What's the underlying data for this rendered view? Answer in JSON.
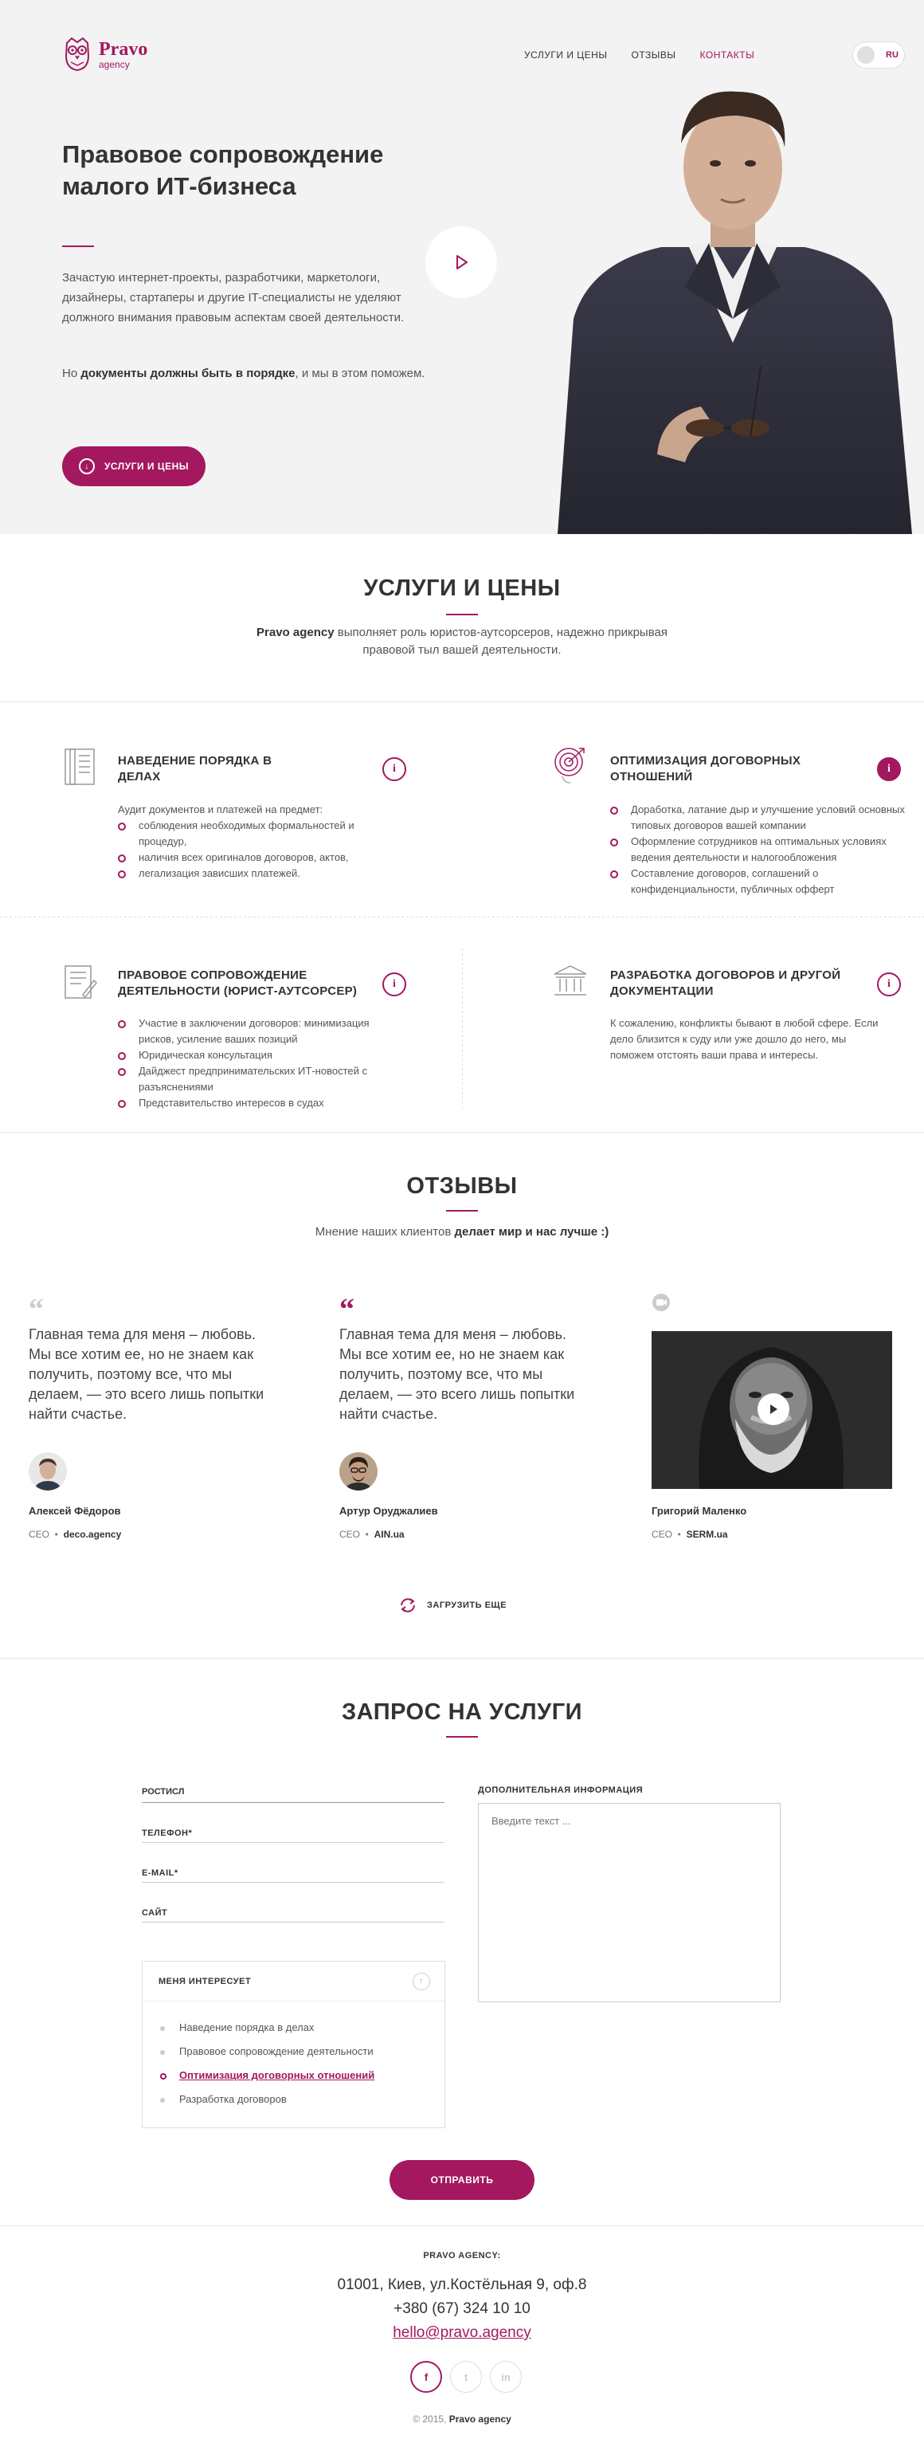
{
  "header": {
    "logo_title": "Pravo",
    "logo_sub": "agency",
    "nav": [
      {
        "label": "УСЛУГИ И ЦЕНЫ"
      },
      {
        "label": "ОТЗЫВЫ"
      },
      {
        "label": "КОНТАКТЫ"
      }
    ],
    "lang": "RU"
  },
  "hero": {
    "title": "Правовое сопровождение малого ИТ-бизнеса",
    "text": "Зачастую интернет-проекты, разработчики, маркетологи, дизайнеры, стартаперы и другие IT-специалисты не уделяют должного внимания правовым аспектам своей деятельности.",
    "text2_pre": "Но ",
    "text2_bold": "документы должны быть в порядке",
    "text2_post": ", и мы в этом поможем.",
    "button": "УСЛУГИ И ЦЕНЫ"
  },
  "services": {
    "title": "УСЛУГИ И ЦЕНЫ",
    "sub_bold": "Pravo agency",
    "sub_text": " выполняет роль юристов-аутсорсеров, надежно прикрывая правовой тыл вашей деятельности.",
    "items": [
      {
        "title": "НАВЕДЕНИЕ ПОРЯДКА В ДЕЛАХ",
        "intro": "Аудит документов и платежей на предмет:",
        "bullets": [
          "соблюдения необходимых формальностей и процедур,",
          "наличия всех оригиналов договоров, актов,",
          "легализация зависших платежей."
        ]
      },
      {
        "title": "ОПТИМИЗАЦИЯ ДОГОВОРНЫХ ОТНОШЕНИЙ",
        "bullets": [
          "Доработка, латание дыр и улучшение условий основных типовых договоров вашей компании",
          "Оформление сотрудников на оптимальных условиях ведения деятельности и налогообложения",
          "Составление договоров, соглашений о конфиденциальности, публичных офферт"
        ]
      },
      {
        "title": "ПРАВОВОЕ СОПРОВОЖДЕНИЕ ДЕЯТЕЛЬНОСТИ (ЮРИСТ-АУТСОРСЕР)",
        "bullets": [
          "Участие в заключении договоров: минимизация рисков, усиление ваших позиций",
          "Юридическая консультация",
          "Дайджест предпринимательских ИТ-новостей с разъяснениями",
          "Представительство интересов в судах"
        ]
      },
      {
        "title": "РАЗРАБОТКА ДОГОВОРОВ И ДРУГОЙ ДОКУМЕНТАЦИИ",
        "text": "К сожалению, конфликты бывают в любой сфере. Если дело близится к суду или уже дошло до него, мы поможем отстоять ваши права и интересы."
      }
    ]
  },
  "reviews": {
    "title": "ОТЗЫВЫ",
    "sub_pre": "Мнение наших клиентов ",
    "sub_bold": "делает мир и нас лучше :)",
    "items": [
      {
        "text": "Главная тема для меня – любовь. Мы все хотим ее, но не знаем как получить, поэтому все, что мы делаем, — это всего лишь попытки найти счастье.",
        "name": "Алексей Фёдоров",
        "role": "CEO",
        "company": "deco.agency"
      },
      {
        "text": "Главная тема для меня – любовь. Мы все хотим ее, но не знаем как получить, поэтому все, что мы делаем, — это всего лишь попытки найти счастье.",
        "name": "Артур Оруджалиев",
        "role": "CEO",
        "company": "AIN.ua"
      },
      {
        "name": "Григорий Маленко",
        "role": "CEO",
        "company": "SERM.ua"
      }
    ],
    "load_more": "ЗАГРУЗИТЬ ЕЩЕ"
  },
  "form": {
    "title": "ЗАПРОС НА УСЛУГИ",
    "name_value": "РОСТИСЛ",
    "phone_label": "ТЕЛЕФОН*",
    "email_label": "E-MAIL*",
    "site_label": "САЙТ",
    "extra_label": "ДОПОЛНИТЕЛЬНАЯ ИНФОРМАЦИЯ",
    "extra_placeholder": "Введите текст ...",
    "interest_label": "МЕНЯ ИНТЕРЕСУЕТ",
    "interests": [
      "Наведение порядка в делах",
      "Правовое сопровождение деятельности",
      "Оптимизация договорных отношений",
      "Разработка договоров"
    ],
    "selected_interest": 2,
    "submit": "ОТПРАВИТЬ"
  },
  "footer": {
    "title": "PRAVO AGENCY:",
    "address": "01001, Киев, ул.Костёльная 9, оф.8",
    "phone": "+380 (67) 324 10 10",
    "email": "hello@pravo.agency",
    "socials": [
      "f",
      "t",
      "in"
    ],
    "copy_pre": "© 2015, ",
    "copy_bold": "Pravo agency"
  },
  "colors": {
    "accent": "#a3185e",
    "hero_bg": "#f3f3f3"
  }
}
